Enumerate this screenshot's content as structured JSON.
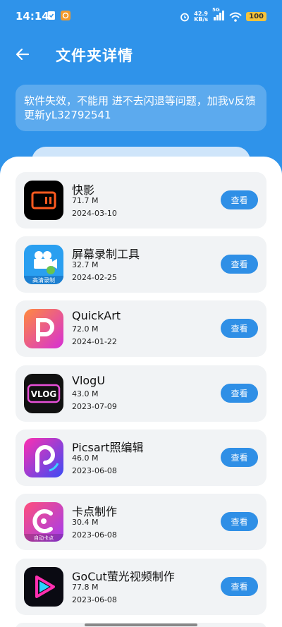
{
  "status_bar": {
    "time": "14:14",
    "net_speed_value": "42.9",
    "net_speed_unit": "KB/s",
    "signal_label": "5G",
    "battery": "100"
  },
  "header": {
    "title": "文件夹详情",
    "back_icon": "arrow-left-icon"
  },
  "notice": {
    "text": "软件失效，不能用 进不去闪退等问题，加我v反馈更新yL32792541"
  },
  "apps": [
    {
      "name": "快影",
      "size": "71.7 M",
      "date": "2024-03-10",
      "button": "查看",
      "icon": "kuaiying-icon"
    },
    {
      "name": "屏幕录制工具",
      "size": "32.7 M",
      "date": "2024-02-25",
      "button": "查看",
      "icon": "screen-recorder-icon",
      "icon_text": "高清录制"
    },
    {
      "name": "QuickArt",
      "size": "72.0 M",
      "date": "2024-01-22",
      "button": "查看",
      "icon": "quickart-icon"
    },
    {
      "name": "VlogU",
      "size": "43.0 M",
      "date": "2023-07-09",
      "button": "查看",
      "icon": "vlogu-icon",
      "icon_text": "VLOG"
    },
    {
      "name": "Picsart照编辑",
      "size": "46.0 M",
      "date": "2023-06-08",
      "button": "查看",
      "icon": "picsart-icon"
    },
    {
      "name": "卡点制作",
      "size": "30.4 M",
      "date": "2023-06-08",
      "button": "查看",
      "icon": "kadian-icon",
      "icon_text": "自动卡点"
    },
    {
      "name": "GoCut萤光视频制作",
      "size": "77.8 M",
      "date": "2023-06-08",
      "button": "查看",
      "icon": "gocut-icon"
    }
  ],
  "colors": {
    "primary": "#2f93ea",
    "button": "#2f8fe6",
    "card": "#f1f3f5"
  }
}
